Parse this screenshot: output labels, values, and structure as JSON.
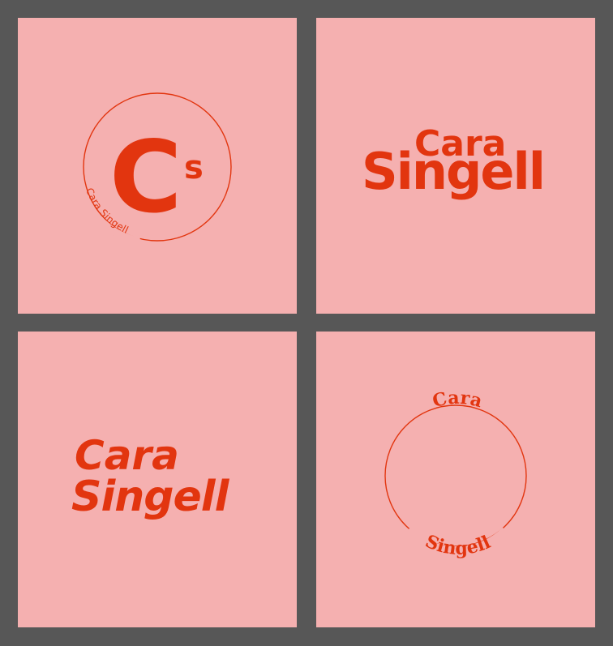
{
  "background_color": "#575757",
  "panel_color": "#f5b0b0",
  "accent_color": "#e2350f",
  "logos": {
    "monogram": {
      "initial": "C",
      "sub_initial": "s",
      "arc_text": "Cara Singell"
    },
    "stacked": {
      "line1": "Cara",
      "line2": "Singell"
    },
    "italic": {
      "line1": "Cara",
      "line2": "Singell"
    },
    "circle_badge": {
      "top_text": "Cara",
      "bottom_text": "Singell"
    }
  }
}
